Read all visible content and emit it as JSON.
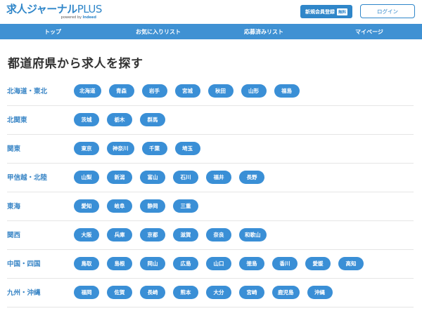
{
  "header": {
    "logo_main": "求人ジャーナル",
    "logo_plus": "PLUS",
    "logo_sub_prefix": "powered by ",
    "logo_sub_brand": "Indeed",
    "register_label": "新規会員登録",
    "register_badge": "無料",
    "login_label": "ログイン"
  },
  "nav": {
    "items": [
      "トップ",
      "お気に入りリスト",
      "応募済みリスト",
      "マイページ"
    ]
  },
  "main": {
    "title": "都道府県から求人を探す",
    "regions": [
      {
        "name": "北海道・東北",
        "prefectures": [
          "北海道",
          "青森",
          "岩手",
          "宮城",
          "秋田",
          "山形",
          "福島"
        ]
      },
      {
        "name": "北関東",
        "prefectures": [
          "茨城",
          "栃木",
          "群馬"
        ]
      },
      {
        "name": "関東",
        "prefectures": [
          "東京",
          "神奈川",
          "千葉",
          "埼玉"
        ]
      },
      {
        "name": "甲信越・北陸",
        "prefectures": [
          "山梨",
          "新潟",
          "富山",
          "石川",
          "福井",
          "長野"
        ]
      },
      {
        "name": "東海",
        "prefectures": [
          "愛知",
          "岐阜",
          "静岡",
          "三重"
        ]
      },
      {
        "name": "関西",
        "prefectures": [
          "大阪",
          "兵庫",
          "京都",
          "滋賀",
          "奈良",
          "和歌山"
        ]
      },
      {
        "name": "中国・四国",
        "prefectures": [
          "鳥取",
          "島根",
          "岡山",
          "広島",
          "山口",
          "徳島",
          "香川",
          "愛媛",
          "高知"
        ]
      },
      {
        "name": "九州・沖縄",
        "prefectures": [
          "福岡",
          "佐賀",
          "長崎",
          "熊本",
          "大分",
          "宮崎",
          "鹿児島",
          "沖縄"
        ]
      }
    ]
  },
  "colors": {
    "brand": "#2f86c9",
    "nav_bg": "#3f91d3",
    "pill_bg": "#3a8fd6",
    "region_text": "#3a86c6"
  }
}
